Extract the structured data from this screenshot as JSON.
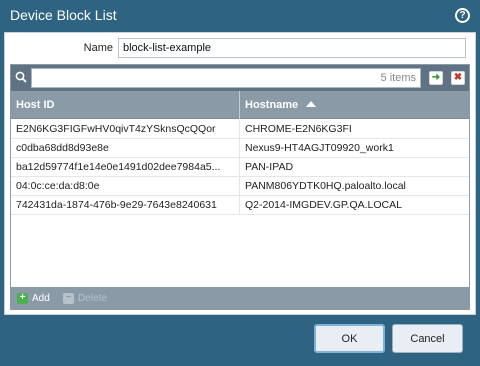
{
  "dialog": {
    "title": "Device Block List",
    "help_icon": "help-icon",
    "help_glyph": "?"
  },
  "form": {
    "name_label": "Name",
    "name_value": "block-list-example"
  },
  "grid": {
    "filter_value": "",
    "item_count": "5 items",
    "apply_filter_icon": "arrow-right-icon",
    "apply_glyph": "➜",
    "clear_filter_icon": "close-icon",
    "clear_glyph": "✖",
    "columns": [
      {
        "label": "Host ID"
      },
      {
        "label": "Hostname",
        "sort": "ascending"
      }
    ],
    "rows": [
      {
        "host_id": "E2N6KG3FIGFwHV0qivT4zYSknsQcQQor",
        "hostname": "CHROME-E2N6KG3FI"
      },
      {
        "host_id": "c0dba68dd8d93e8e",
        "hostname": "Nexus9-HT4AGJT09920_work1"
      },
      {
        "host_id": "ba12d59774f1e14e0e1491d02dee7984a5...",
        "hostname": "PAN-IPAD"
      },
      {
        "host_id": "04:0c:ce:da:d8:0e",
        "hostname": "PANM806YDTK0HQ.paloalto.local"
      },
      {
        "host_id": "742431da-1874-476b-9e29-7643e8240631",
        "hostname": "Q2-2014-IMGDEV.GP.QA.LOCAL"
      }
    ],
    "add_label": "Add",
    "add_glyph": "+",
    "delete_label": "Delete",
    "delete_glyph": "−"
  },
  "actions": {
    "ok_label": "OK",
    "cancel_label": "Cancel"
  },
  "colors": {
    "titlebar": "#2e6482",
    "grid_header": "#8a9aa7",
    "toolbar": "#5f7384",
    "add_icon": "#4caf50",
    "clear_icon": "#c0392b"
  }
}
